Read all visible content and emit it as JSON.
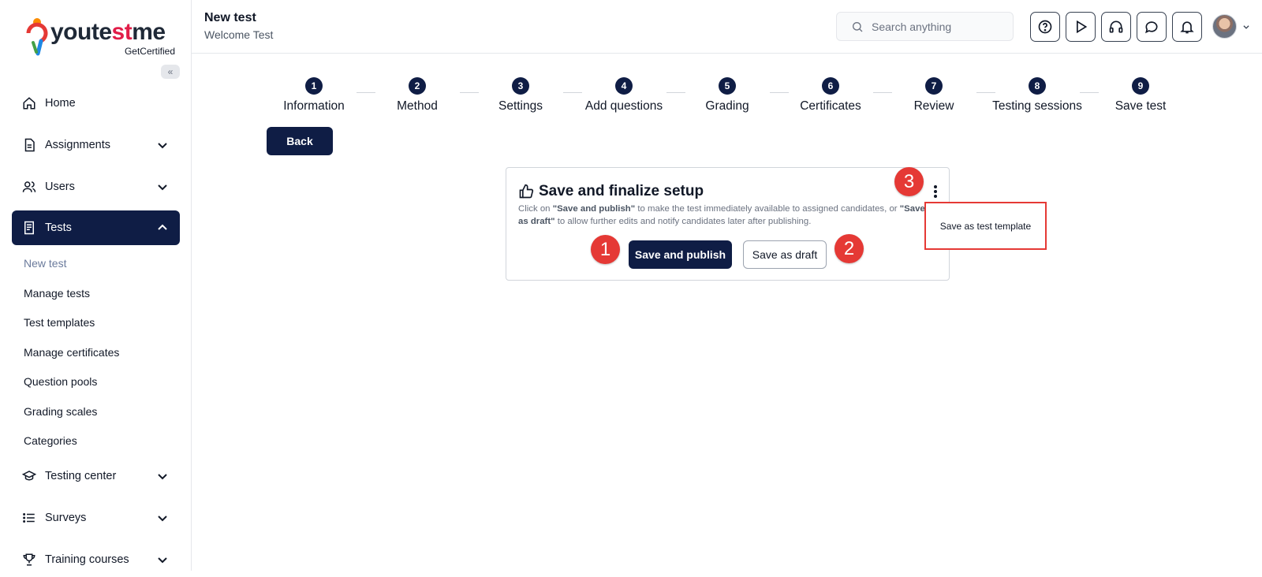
{
  "brand": {
    "name_a": "youte",
    "name_b": "st",
    "name_c": "me",
    "tagline": "GetCertified",
    "collapse_icon": "double-chevron-left-icon"
  },
  "sidebar": {
    "nav": [
      {
        "label": "Home",
        "icon": "home-icon"
      },
      {
        "label": "Assignments",
        "icon": "document-icon"
      },
      {
        "label": "Users",
        "icon": "users-icon"
      },
      {
        "label": "Tests",
        "icon": "test-icon",
        "active": true
      },
      {
        "label": "Testing center",
        "icon": "graduation-cap-icon"
      },
      {
        "label": "Surveys",
        "icon": "list-icon"
      },
      {
        "label": "Training courses",
        "icon": "trophy-icon"
      }
    ],
    "tests_sub": [
      "New test",
      "Manage tests",
      "Test templates",
      "Manage certificates",
      "Question pools",
      "Grading scales",
      "Categories"
    ]
  },
  "header": {
    "title": "New test",
    "subtitle": "Welcome Test",
    "search_placeholder": "Search anything",
    "toolbar_icons": [
      "help-icon",
      "play-icon",
      "headset-icon",
      "chat-icon",
      "bell-icon"
    ]
  },
  "steps": [
    {
      "num": "1",
      "label": "Information"
    },
    {
      "num": "2",
      "label": "Method"
    },
    {
      "num": "3",
      "label": "Settings"
    },
    {
      "num": "4",
      "label": "Add questions"
    },
    {
      "num": "5",
      "label": "Grading"
    },
    {
      "num": "6",
      "label": "Certificates"
    },
    {
      "num": "7",
      "label": "Review"
    },
    {
      "num": "8",
      "label": "Testing sessions"
    },
    {
      "num": "9",
      "label": "Save test"
    }
  ],
  "back_label": "Back",
  "card": {
    "title": "Save and finalize setup",
    "desc_1": "Click on ",
    "desc_publish": "\"Save and publish\"",
    "desc_2": " to make the test immediately available to assigned candidates, or ",
    "desc_draft": "\"Save as draft\"",
    "desc_3": " to allow further edits and notify candidates later after publishing.",
    "publish_label": "Save and publish",
    "draft_label": "Save as draft"
  },
  "badges": [
    "1",
    "2",
    "3"
  ],
  "menu": {
    "item": "Save as test template"
  },
  "colors": {
    "primary": "#0f1d45",
    "annotation": "#e53935"
  }
}
